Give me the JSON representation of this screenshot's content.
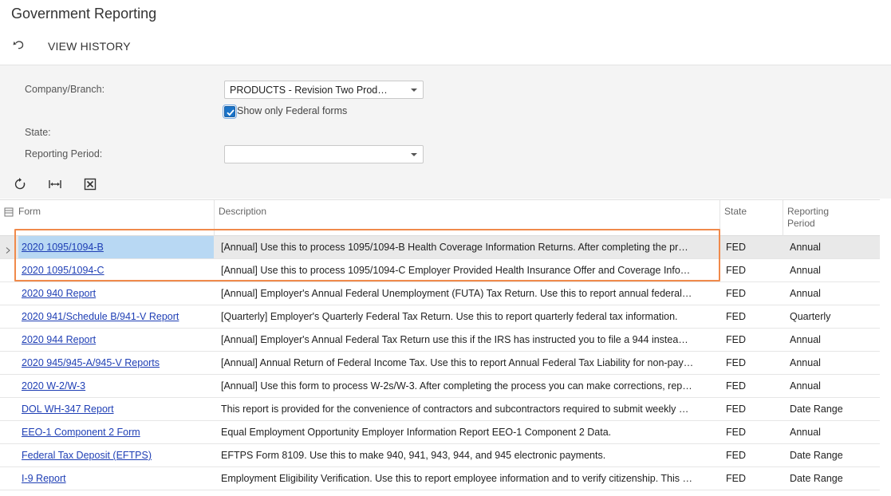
{
  "page": {
    "title": "Government Reporting"
  },
  "toolbar": {
    "view_history_label": "VIEW HISTORY",
    "undo_icon": "undo-icon"
  },
  "filters": {
    "company_label": "Company/Branch:",
    "company_value": "PRODUCTS - Revision Two Prod…",
    "federal_checkbox_label": "Show only Federal forms",
    "federal_checkbox_checked": true,
    "state_label": "State:",
    "period_label": "Reporting Period:",
    "period_value": ""
  },
  "grid_toolbar": {
    "refresh_icon": "refresh-icon",
    "fit_icon": "fit-columns-icon",
    "excel_icon": "export-excel-icon"
  },
  "grid": {
    "columns": {
      "form": "Form",
      "description": "Description",
      "state": "State",
      "period_line1": "Reporting",
      "period_line2": "Period"
    },
    "rows": [
      {
        "form": "2020 1095/1094-B",
        "description": "[Annual] Use this to process 1095/1094-B Health Coverage Information Returns. After completing the pr…",
        "state": "FED",
        "period": "Annual"
      },
      {
        "form": "2020 1095/1094-C",
        "description": "[Annual] Use this to process 1095/1094-C Employer Provided Health Insurance Offer and Coverage Info…",
        "state": "FED",
        "period": "Annual"
      },
      {
        "form": "2020 940 Report",
        "description": "[Annual] Employer's Annual Federal Unemployment (FUTA) Tax Return. Use this to report annual federal…",
        "state": "FED",
        "period": "Annual"
      },
      {
        "form": "2020 941/Schedule B/941-V Report",
        "description": "[Quarterly] Employer's Quarterly Federal Tax Return. Use this to report quarterly federal tax information.",
        "state": "FED",
        "period": "Quarterly"
      },
      {
        "form": "2020 944 Report",
        "description": "[Annual] Employer's Annual Federal Tax Return use this if the IRS has instructed you to file a 944 instea…",
        "state": "FED",
        "period": "Annual"
      },
      {
        "form": "2020 945/945-A/945-V Reports",
        "description": "[Annual] Annual Return of Federal Income Tax. Use this to report Annual Federal Tax Liability for non-pay…",
        "state": "FED",
        "period": "Annual"
      },
      {
        "form": "2020 W-2/W-3",
        "description": "[Annual] Use this form to process W-2s/W-3. After completing the process you can make corrections, rep…",
        "state": "FED",
        "period": "Annual"
      },
      {
        "form": "DOL WH-347 Report",
        "description": "This report is provided for the convenience of contractors and subcontractors required to submit weekly …",
        "state": "FED",
        "period": "Date Range"
      },
      {
        "form": "EEO-1 Component 2 Form",
        "description": "Equal Employment Opportunity Employer Information Report EEO-1 Component 2 Data.",
        "state": "FED",
        "period": "Annual"
      },
      {
        "form": "Federal Tax Deposit (EFTPS)",
        "description": "EFTPS Form 8109. Use this to make 940, 941, 943, 944, and 945 electronic payments.",
        "state": "FED",
        "period": "Date Range"
      },
      {
        "form": "I-9 Report",
        "description": "Employment Eligibility Verification. Use this to report employee information and to verify citizenship. This …",
        "state": "FED",
        "period": "Date Range"
      }
    ]
  },
  "colors": {
    "link": "#1f3fb5",
    "highlight": "#f08a4b",
    "selected_cell": "#b8d8f3",
    "checkbox": "#1a73c8"
  }
}
